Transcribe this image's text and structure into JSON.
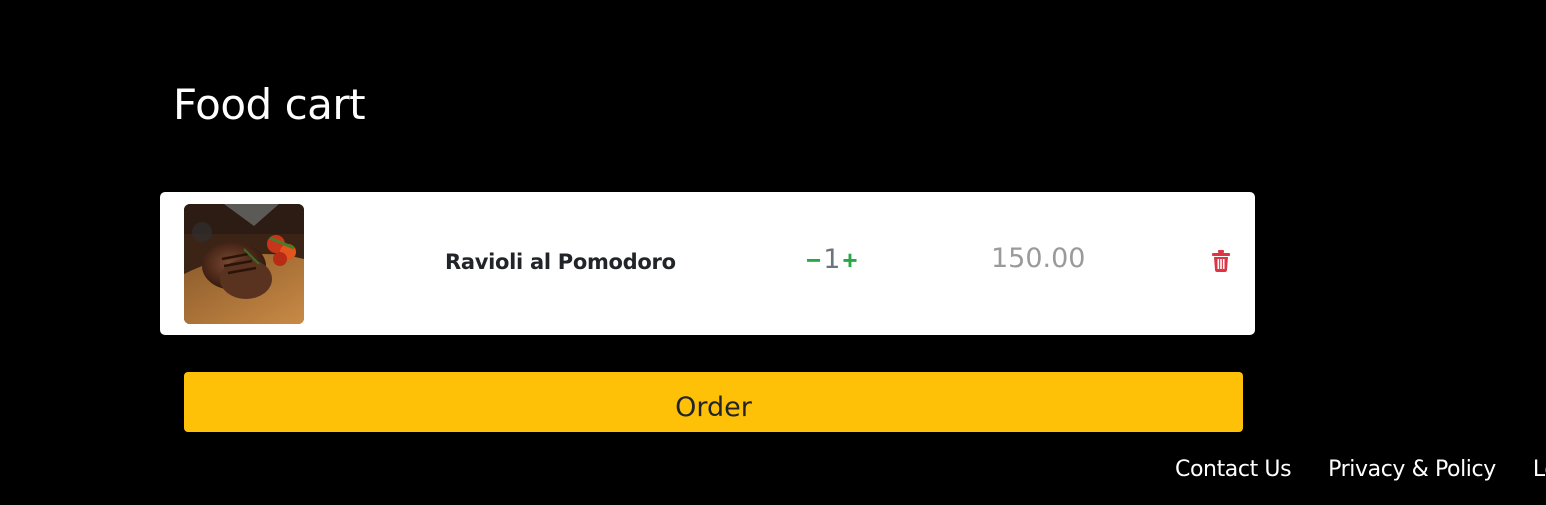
{
  "page": {
    "title": "Food cart"
  },
  "cart": {
    "items": [
      {
        "name": "Ravioli al Pomodoro",
        "image_icon": "steak-dish-photo",
        "quantity": "1",
        "decrease_label": "−",
        "increase_label": "+",
        "price": "150.00",
        "delete_icon": "trash-icon"
      }
    ]
  },
  "order_button": {
    "label": "Order"
  },
  "footer": {
    "links": [
      "Contact Us",
      "Privacy & Policy",
      "Lo"
    ]
  },
  "colors": {
    "background": "#000000",
    "card": "#ffffff",
    "order_button": "#ffc107",
    "quantity_controls": "#28a745",
    "price_text": "#9a9a9a",
    "delete_icon": "#dc3545"
  }
}
